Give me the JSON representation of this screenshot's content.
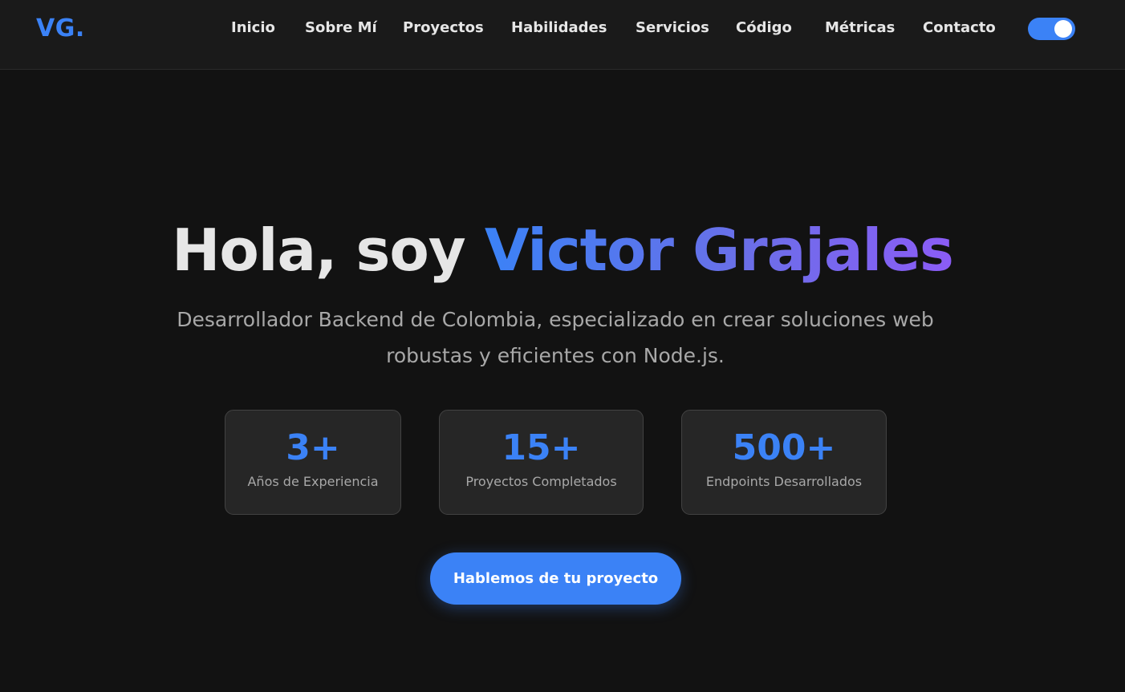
{
  "logo": "VG.",
  "nav": {
    "links": [
      "Inicio",
      "Sobre Mí",
      "Proyectos",
      "Habilidades",
      "Servicios",
      "Código",
      "Métricas",
      "Contacto"
    ],
    "theme_toggle_on": true
  },
  "hero": {
    "greeting": "Hola, soy ",
    "name": "Victor Grajales",
    "subtitle": "Desarrollador Backend de Colombia, especializado en crear soluciones web robustas y eficientes con Node.js.",
    "stats": [
      {
        "value": "3+",
        "label": "Años de Experiencia"
      },
      {
        "value": "15+",
        "label": "Proyectos Completados"
      },
      {
        "value": "500+",
        "label": "Endpoints Desarrollados"
      }
    ],
    "cta": "Hablemos de tu proyecto"
  },
  "colors": {
    "accent": "#3b82f6",
    "gradient_end": "#8b5cf6",
    "background": "#121212",
    "navbar": "#1a1a1a",
    "card": "#262626"
  }
}
